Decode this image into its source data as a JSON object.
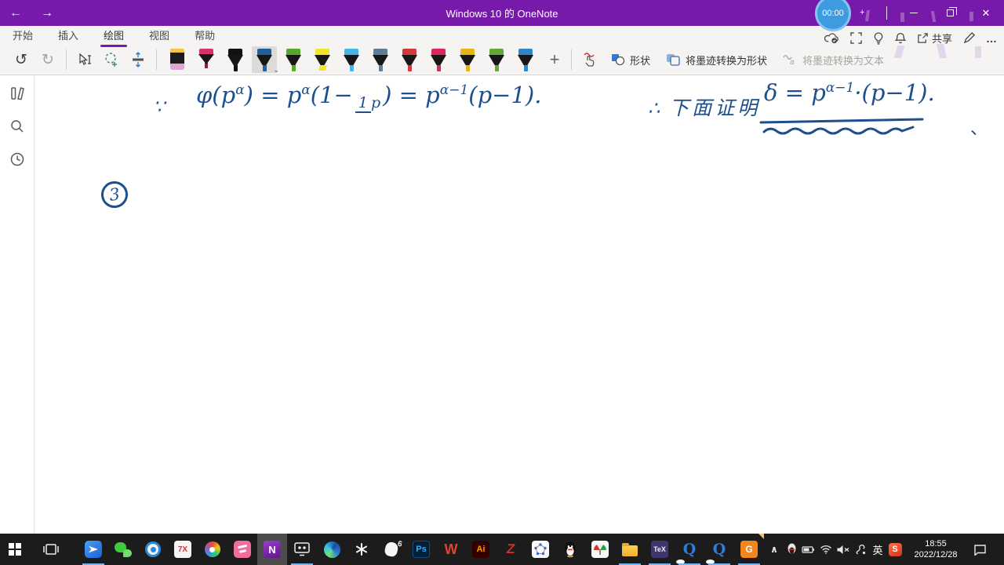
{
  "colors": {
    "titlebar": "#7719aa",
    "accent": "#7719aa",
    "ink": "#1d4f8f",
    "taskbar": "#1c1c1c",
    "timer_fill": "#3f9be0",
    "open_indicator": "#71b6f0"
  },
  "titlebar": {
    "title": "Windows 10 的 OneNote"
  },
  "recorder": {
    "timer": "00:00",
    "plus": "+"
  },
  "ribbon": {
    "tabs": [
      {
        "label": "开始"
      },
      {
        "label": "插入"
      },
      {
        "label": "绘图"
      },
      {
        "label": "视图"
      },
      {
        "label": "帮助"
      }
    ],
    "selected_tab": "绘图",
    "share_label": "共享",
    "more_glyph": "…",
    "add_pen_glyph": "+",
    "undo_glyph": "↺",
    "redo_glyph": "↻",
    "shapes_label": "形状",
    "ink_to_shape_label": "将墨迹转换为形状",
    "ink_to_text_label": "将墨迹转换为文本",
    "pen_chevron": "⌄",
    "pens": [
      {
        "name": "eraser"
      },
      {
        "name": "pencil",
        "color": "#d6336c"
      },
      {
        "name": "black-pen",
        "color": "#111111"
      },
      {
        "name": "blue-pen",
        "color": "#1f5f9e",
        "selected": true
      },
      {
        "name": "green-pen",
        "color": "#56a829"
      },
      {
        "name": "yellow-highlighter",
        "color": "#f2e42a"
      },
      {
        "name": "sky-blue-pen",
        "color": "#45b5e8"
      },
      {
        "name": "steel-pen",
        "color": "#5f7d99"
      },
      {
        "name": "red-pen",
        "color": "#d23b3b"
      },
      {
        "name": "magenta-pen",
        "color": "#e0245e"
      },
      {
        "name": "gold-pen",
        "color": "#e7b416"
      },
      {
        "name": "lime-pen",
        "color": "#63a832"
      },
      {
        "name": "azure-pen",
        "color": "#2f86c9"
      }
    ]
  },
  "handwriting": {
    "ink_color": "#1d4f8f",
    "because": "∵",
    "phi_open": "φ(p",
    "sup_alpha": "α",
    "close_eq_p": ") = p",
    "open_one_minus": "(1−",
    "frac_num": "1",
    "frac_den": "p",
    "close_eq_p2": ") = p",
    "sup_alpha_m1": "α−1",
    "p_minus_one": "(p−1).",
    "therefore": "∴",
    "claim": "下面证明",
    "delta_eq": "δ = p",
    "delta_sup": "α−1",
    "delta_tail": "·(p−1).",
    "tick": "、",
    "circled_number": "3"
  },
  "taskbar": {
    "items": [
      {
        "name": "start"
      },
      {
        "name": "task-view"
      },
      {
        "name": "blue-arrow-app"
      },
      {
        "name": "wechat"
      },
      {
        "name": "aperture-app"
      },
      {
        "name": "seven-x-app",
        "glyph": "7X"
      },
      {
        "name": "palette-app"
      },
      {
        "name": "pink-app"
      },
      {
        "name": "onenote",
        "glyph": "N"
      },
      {
        "name": "monitor-app"
      },
      {
        "name": "edge"
      },
      {
        "name": "flower-app"
      },
      {
        "name": "glove-app",
        "glyph": "6"
      },
      {
        "name": "photoshop",
        "glyph": "Ps"
      },
      {
        "name": "wps",
        "glyph": "W"
      },
      {
        "name": "illustrator",
        "glyph": "Ai"
      },
      {
        "name": "z-app",
        "glyph": "Z"
      },
      {
        "name": "geometry-app"
      },
      {
        "name": "qq"
      },
      {
        "name": "sketchpad"
      },
      {
        "name": "file-explorer"
      },
      {
        "name": "tex-app",
        "glyph": "TeX"
      },
      {
        "name": "qq-browser-1",
        "glyph": "Q"
      },
      {
        "name": "qq-browser-2",
        "glyph": "Q"
      },
      {
        "name": "g-app",
        "glyph": "G"
      }
    ],
    "tray": {
      "caret": "∧",
      "ime": "英",
      "sogou_glyph": "S",
      "time": "18:55",
      "date": "2022/12/28"
    }
  }
}
